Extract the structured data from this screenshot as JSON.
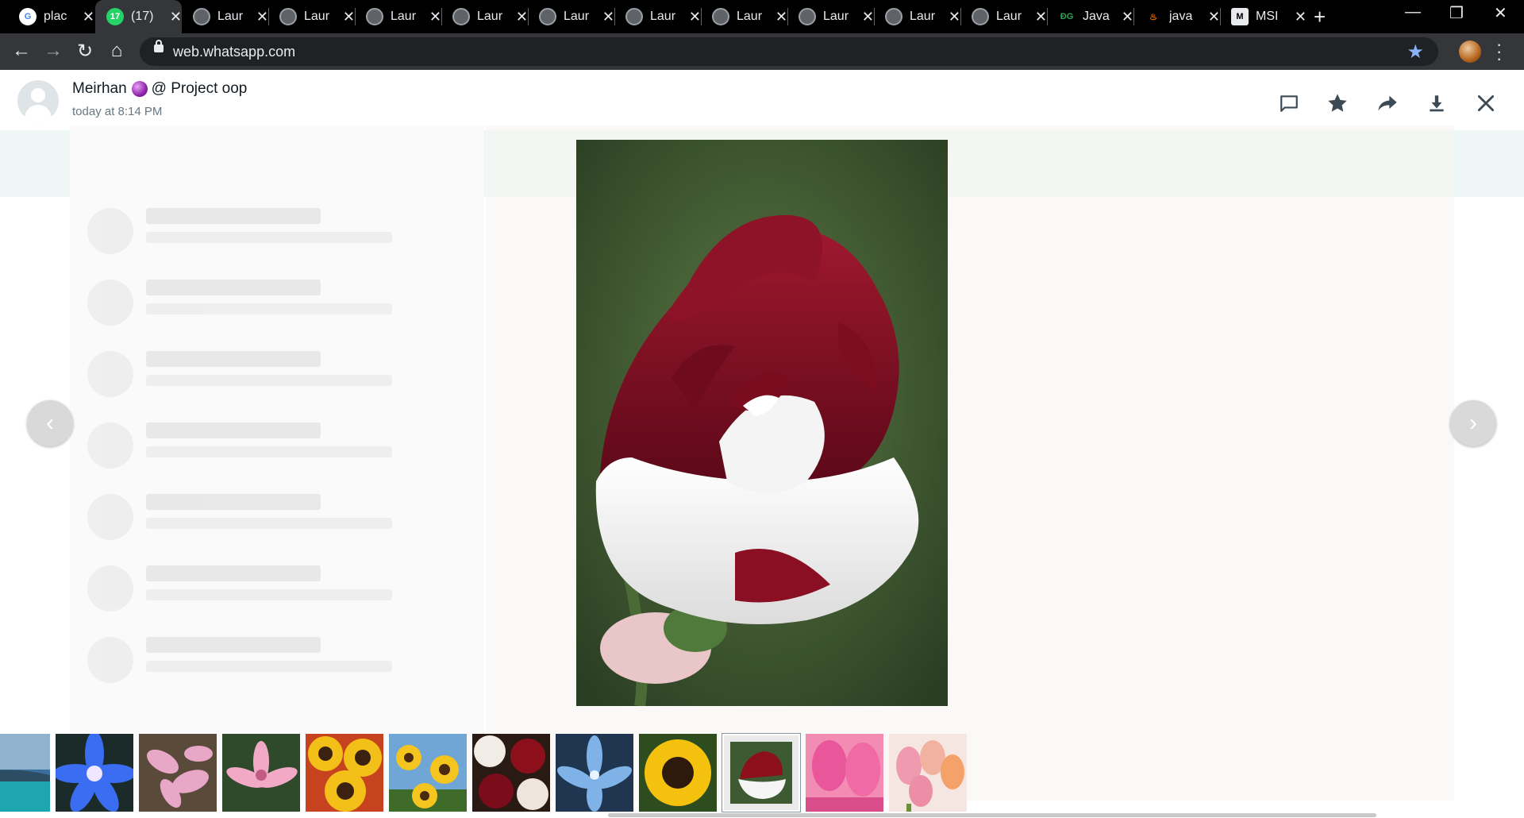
{
  "browser": {
    "tabs": [
      {
        "title": "plac",
        "favicon": "google-icon"
      },
      {
        "title": "(17)",
        "favicon": "whatsapp-icon",
        "active": true
      },
      {
        "title": "Laur",
        "favicon": "globe-icon"
      },
      {
        "title": "Laur",
        "favicon": "globe-icon"
      },
      {
        "title": "Laur",
        "favicon": "globe-icon"
      },
      {
        "title": "Laur",
        "favicon": "globe-icon"
      },
      {
        "title": "Laur",
        "favicon": "globe-icon"
      },
      {
        "title": "Laur",
        "favicon": "globe-icon"
      },
      {
        "title": "Laur",
        "favicon": "globe-icon"
      },
      {
        "title": "Laur",
        "favicon": "globe-icon"
      },
      {
        "title": "Laur",
        "favicon": "globe-icon"
      },
      {
        "title": "Laur",
        "favicon": "globe-icon"
      },
      {
        "title": "Java",
        "favicon": "dg-icon"
      },
      {
        "title": "java",
        "favicon": "java-icon"
      },
      {
        "title": "MSI",
        "favicon": "msp-icon"
      }
    ],
    "url": "web.whatsapp.com",
    "accent": "#8ab4f8"
  },
  "viewer": {
    "sender": "Meirhan",
    "group": "@ Project oop",
    "timestamp": "today at 8:14 PM",
    "actions": [
      "reply-icon",
      "star-icon",
      "forward-icon",
      "download-icon",
      "close-icon"
    ],
    "thumbnails": [
      "ocean",
      "blue lily",
      "pink lilies",
      "pink lily",
      "sunflowers",
      "sunflowers sky",
      "red white roses",
      "blue lily 2",
      "sunflower",
      "red white rose",
      "pink tulips",
      "tulips"
    ],
    "selected_thumbnail": 9
  }
}
